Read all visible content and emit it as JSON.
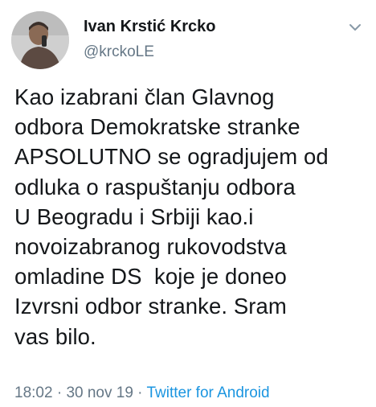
{
  "tweet": {
    "author": {
      "name": "Ivan Krstić Krcko",
      "handle": "@krckoLE",
      "avatar_icon": "profile-photo"
    },
    "menu_icon": "chevron-down-icon",
    "text_lines": [
      "Kao izabrani član Glavnog",
      "odbora Demokratske stranke",
      "APSOLUTNO se ogradjujem od",
      "odluka o raspuštanju odbora",
      "U Beogradu i Srbiji kao.i",
      "novoizabranog rukovodstva",
      "omladine DS  koje je doneo",
      "Izvrsni odbor stranke. Sram",
      "vas bilo."
    ],
    "time": "18:02",
    "separator": " · ",
    "date": "30 nov 19",
    "source": "Twitter for Android"
  },
  "colors": {
    "text": "#14171a",
    "secondary": "#657786",
    "link": "#1b95e0"
  }
}
